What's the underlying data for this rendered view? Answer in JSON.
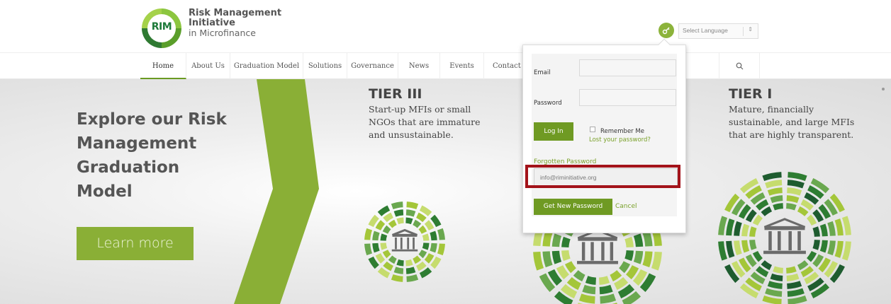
{
  "logo": {
    "mark_text": "RIM",
    "line1": "Risk Management",
    "line2": "Initiative",
    "line3": "in Microfinance"
  },
  "header": {
    "key_icon": "key-icon",
    "language_select": {
      "value": "Select Language",
      "arrow": "⇕"
    }
  },
  "nav": {
    "items": [
      {
        "label": "Home",
        "active": true
      },
      {
        "label": "About Us"
      },
      {
        "label": "Graduation Model"
      },
      {
        "label": "Solutions"
      },
      {
        "label": "Governance"
      },
      {
        "label": "News"
      },
      {
        "label": "Events"
      },
      {
        "label": "Contact"
      }
    ],
    "search_icon": "search-icon"
  },
  "hero": {
    "title_lines": [
      "Explore our Risk",
      "Management",
      "Graduation",
      "Model"
    ],
    "cta_label": "Learn more",
    "tiers": [
      {
        "title": "TIER III",
        "desc_lines": [
          "Start-up MFIs or small",
          "NGOs that are immature",
          "and unsustainable."
        ]
      },
      {
        "title": "TIER I",
        "desc_lines": [
          "Mature, financially",
          "sustainable, and large MFIs",
          "that are highly transparent."
        ]
      }
    ],
    "colors": {
      "chevron": "#8aaf36",
      "accent": "#6f9a23",
      "dark_green": "#1e5c2f"
    }
  },
  "login_popup": {
    "email_label": "Email",
    "password_label": "Password",
    "email_value": "",
    "password_value": "",
    "remember_label": "Remember Me",
    "remember_checked": false,
    "login_button": "Log In",
    "lost_password_link": "Lost your password?",
    "forgotten_heading": "Forgotten Password",
    "reset_email_value": "info@riminitiative.org",
    "get_password_button": "Get New Password",
    "cancel_link": "Cancel"
  }
}
